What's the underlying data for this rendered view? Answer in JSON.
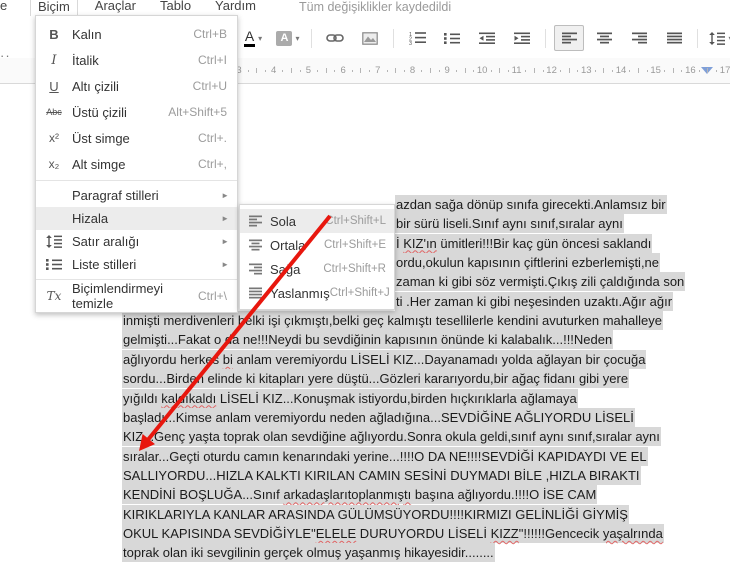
{
  "menubar": {
    "partial_left": "e",
    "items": [
      "Biçim",
      "Araçlar",
      "Tablo",
      "Yardım"
    ],
    "open_item": "Biçim",
    "status": "Tüm değişiklikler kaydedildi"
  },
  "toolbar": {
    "partial_marks": "··",
    "buttons": [
      {
        "name": "text-color-button",
        "icon": "text-color-icon",
        "dropdown": true
      },
      {
        "name": "highlight-color-button",
        "icon": "highlight-color-icon",
        "dropdown": true
      },
      {
        "name": "separator"
      },
      {
        "name": "insert-link-button",
        "icon": "link-icon"
      },
      {
        "name": "insert-image-button",
        "icon": "image-icon"
      },
      {
        "name": "separator"
      },
      {
        "name": "numbered-list-button",
        "icon": "numbered-list-icon"
      },
      {
        "name": "bulleted-list-button",
        "icon": "bulleted-list-icon"
      },
      {
        "name": "decrease-indent-button",
        "icon": "outdent-icon"
      },
      {
        "name": "increase-indent-button",
        "icon": "indent-icon"
      },
      {
        "name": "separator"
      },
      {
        "name": "align-left-button",
        "icon": "align-left-icon",
        "active": true
      },
      {
        "name": "align-center-button",
        "icon": "align-center-icon"
      },
      {
        "name": "align-right-button",
        "icon": "align-right-icon"
      },
      {
        "name": "align-justify-button",
        "icon": "align-justify-icon"
      },
      {
        "name": "separator"
      },
      {
        "name": "line-spacing-button",
        "icon": "line-spacing-icon",
        "dropdown": true
      }
    ]
  },
  "ruler": {
    "numbers": [
      3,
      4,
      5,
      6,
      7,
      8,
      9,
      10,
      11,
      12,
      13,
      14,
      15,
      16,
      17
    ]
  },
  "format_menu": {
    "items": [
      {
        "type": "item",
        "icon": "bold-icon",
        "glyph": "B",
        "label": "Kalın",
        "shortcut": "Ctrl+B"
      },
      {
        "type": "item",
        "icon": "italic-icon",
        "glyph": "I",
        "label": "İtalik",
        "shortcut": "Ctrl+I"
      },
      {
        "type": "item",
        "icon": "underline-icon",
        "glyph": "U",
        "label": "Altı çizili",
        "shortcut": "Ctrl+U"
      },
      {
        "type": "item",
        "icon": "strikethrough-icon",
        "glyph": "Abc",
        "label": "Üstü çizili",
        "shortcut": "Alt+Shift+5"
      },
      {
        "type": "item",
        "icon": "superscript-icon",
        "glyph": "x²",
        "label": "Üst simge",
        "shortcut": "Ctrl+."
      },
      {
        "type": "item",
        "icon": "subscript-icon",
        "glyph": "x₂",
        "label": "Alt simge",
        "shortcut": "Ctrl+,"
      },
      {
        "type": "sep"
      },
      {
        "type": "item",
        "label": "Paragraf stilleri",
        "submenu": true
      },
      {
        "type": "item",
        "label": "Hizala",
        "submenu": true,
        "active": true
      },
      {
        "type": "item",
        "icon": "line-spacing-icon",
        "label": "Satır aralığı",
        "submenu": true
      },
      {
        "type": "item",
        "icon": "bulleted-list-icon",
        "label": "Liste stilleri",
        "submenu": true
      },
      {
        "type": "sep"
      },
      {
        "type": "item",
        "icon": "clear-formatting-icon",
        "glyph": "Tx",
        "label": "Biçimlendirmeyi temizle",
        "shortcut": "Ctrl+\\"
      }
    ]
  },
  "align_submenu": {
    "items": [
      {
        "icon": "align-left-icon",
        "label": "Sola",
        "shortcut": "Ctrl+Shift+L",
        "active": true
      },
      {
        "icon": "align-center-icon",
        "label": "Ortala",
        "shortcut": "Ctrl+Shift+E"
      },
      {
        "icon": "align-right-icon",
        "label": "Sağa",
        "shortcut": "Ctrl+Shift+R"
      },
      {
        "icon": "align-justify-icon",
        "label": "Yaslanmış",
        "shortcut": "Ctrl+Shift+J"
      }
    ]
  },
  "document": {
    "lines": [
      {
        "indent": "partial",
        "segments": [
          {
            "t": "azdan sağa dönüp sınıfa girecekti.Anlamsız bir"
          }
        ]
      },
      {
        "indent": "partial",
        "segments": [
          {
            "t": "bir sürü liseli.Sınıf aynı sınıf,sıralar aynı"
          }
        ]
      },
      {
        "indent": "partial",
        "segments": [
          {
            "t": "İ "
          },
          {
            "t": "KIZ'ın",
            "sp": true
          },
          {
            "t": " ümitleri!!!Bir kaç gün öncesi saklandı"
          }
        ]
      },
      {
        "indent": "partial",
        "segments": [
          {
            "t": "ordu,okulun kapısının çiftlerini ezberlemişti,ne"
          }
        ]
      },
      {
        "indent": "partial",
        "segments": [
          {
            "t": "zaman ki gibi söz vermişti.Çıkış zili çaldığında son"
          }
        ]
      },
      {
        "indent": "partial",
        "segments": [
          {
            "t": "ti .Her zaman ki gibi neşesinden uzaktı.Ağır ağır"
          }
        ]
      },
      {
        "indent": "full",
        "segments": [
          {
            "t": "inmişti merdivenleri belki işi çıkmıştı,belki geç kalmıştı tesellilerle kendini avuturken mahalleye"
          }
        ]
      },
      {
        "indent": "full",
        "segments": [
          {
            "t": "gelmişti...Fakat o da ne!!!Neydi bu sevdiğinin kapısının önünde ki kalabalık...!!!Neden"
          }
        ]
      },
      {
        "indent": "full",
        "segments": [
          {
            "t": "ağlıyordu herkes "
          },
          {
            "t": "bi",
            "sp": true
          },
          {
            "t": " anlam veremiyordu LİSELİ KIZ...Dayanamadı yolda ağlayan bir çocuğa"
          }
        ]
      },
      {
        "indent": "full",
        "segments": [
          {
            "t": "sordu...Birden elinde ki kitapları yere düştü...Gözleri kararıyordu,bir ağaç fidanı gibi yere"
          }
        ]
      },
      {
        "indent": "full",
        "segments": [
          {
            "t": "yığıldı "
          },
          {
            "t": "kaldıkaldı",
            "sp": true
          },
          {
            "t": " LİSELİ KIZ...Konuşmak istiyordu,birden hıçkırıklarla ağlamaya"
          }
        ]
      },
      {
        "indent": "full",
        "segments": [
          {
            "t": "başladı...Kimse anlam veremiyordu neden ağladığına...SEVDİĞİNE AĞLIYORDU LİSELİ"
          }
        ]
      },
      {
        "indent": "full",
        "segments": [
          {
            "t": "KIZ...Genç yaşta toprak olan sevdiğine ağlıyordu.Sonra okula geldi,sınıf aynı sınıf,sıralar aynı"
          }
        ]
      },
      {
        "indent": "full",
        "segments": [
          {
            "t": "sıralar...Geçti oturdu camın kenarındaki yerine...!!!!O DA NE!!!!SEVDİĞİ KAPIDAYDI VE EL"
          }
        ]
      },
      {
        "indent": "full",
        "segments": [
          {
            "t": "SALLIYORDU...HIZLA KALKTI KIRILAN CAMIN SESİNİ DUYMADI BİLE ,HIZLA BIRAKTI"
          }
        ]
      },
      {
        "indent": "full",
        "segments": [
          {
            "t": "KENDİNİ BOŞLUĞA...Sınıf "
          },
          {
            "t": "arkadaşlarıtoplanmıştı",
            "sp": true
          },
          {
            "t": " başına ağlıyordu.!!!!O İSE CAM"
          }
        ]
      },
      {
        "indent": "full",
        "segments": [
          {
            "t": "KIRIKLARIYLA KANLAR ARASINDA GÜLÜMSÜYORDU!!!!KIRMIZI GELİNLİĞİ GİYMİŞ"
          }
        ]
      },
      {
        "indent": "full",
        "segments": [
          {
            "t": "OKUL KAPISINDA SEVDİĞİYLE\""
          },
          {
            "t": "ELELE",
            "sp": true
          },
          {
            "t": " DURUYORDU LİSELİ "
          },
          {
            "t": "KIZZ",
            "sp": true
          },
          {
            "t": "\"!!!!!!Gencecik "
          },
          {
            "t": "yaşalrında",
            "sp": true
          }
        ]
      },
      {
        "indent": "full",
        "segments": [
          {
            "t": "toprak olan iki sevgilinin gerçek olmuş yaşanmış hikayesidir........"
          }
        ]
      }
    ]
  },
  "colors": {
    "selection": "#d8d8d8",
    "squiggle": "#e06666",
    "arrow": "#e8170e",
    "active_row": "#ececec",
    "ruler_marker": "#7f9fd8"
  }
}
